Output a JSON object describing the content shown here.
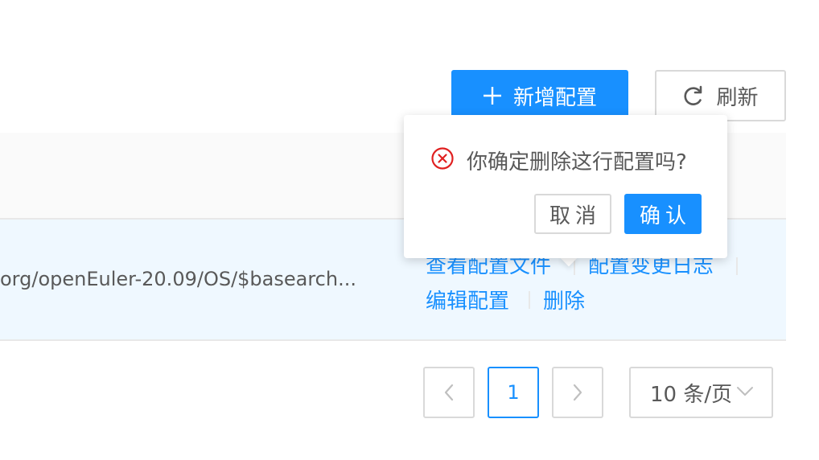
{
  "toolbar": {
    "add_label": "新增配置",
    "refresh_label": "刷新"
  },
  "table": {
    "rows": [
      {
        "repo_url": "org/openEuler-20.09/OS/$basearch...",
        "actions": {
          "view_file": "查看配置文件",
          "change_log": "配置变更日志",
          "edit": "编辑配置",
          "delete": "删除"
        }
      }
    ]
  },
  "popconfirm": {
    "message": "你确定删除这行配置吗?",
    "cancel_label": "取消",
    "ok_label": "确认"
  },
  "pagination": {
    "current_page": "1",
    "page_size_label": "10 条/页"
  },
  "colors": {
    "primary": "#1890ff",
    "danger": "#e02020",
    "row_highlight": "#eff8ff",
    "header_bg": "#fafafa"
  }
}
